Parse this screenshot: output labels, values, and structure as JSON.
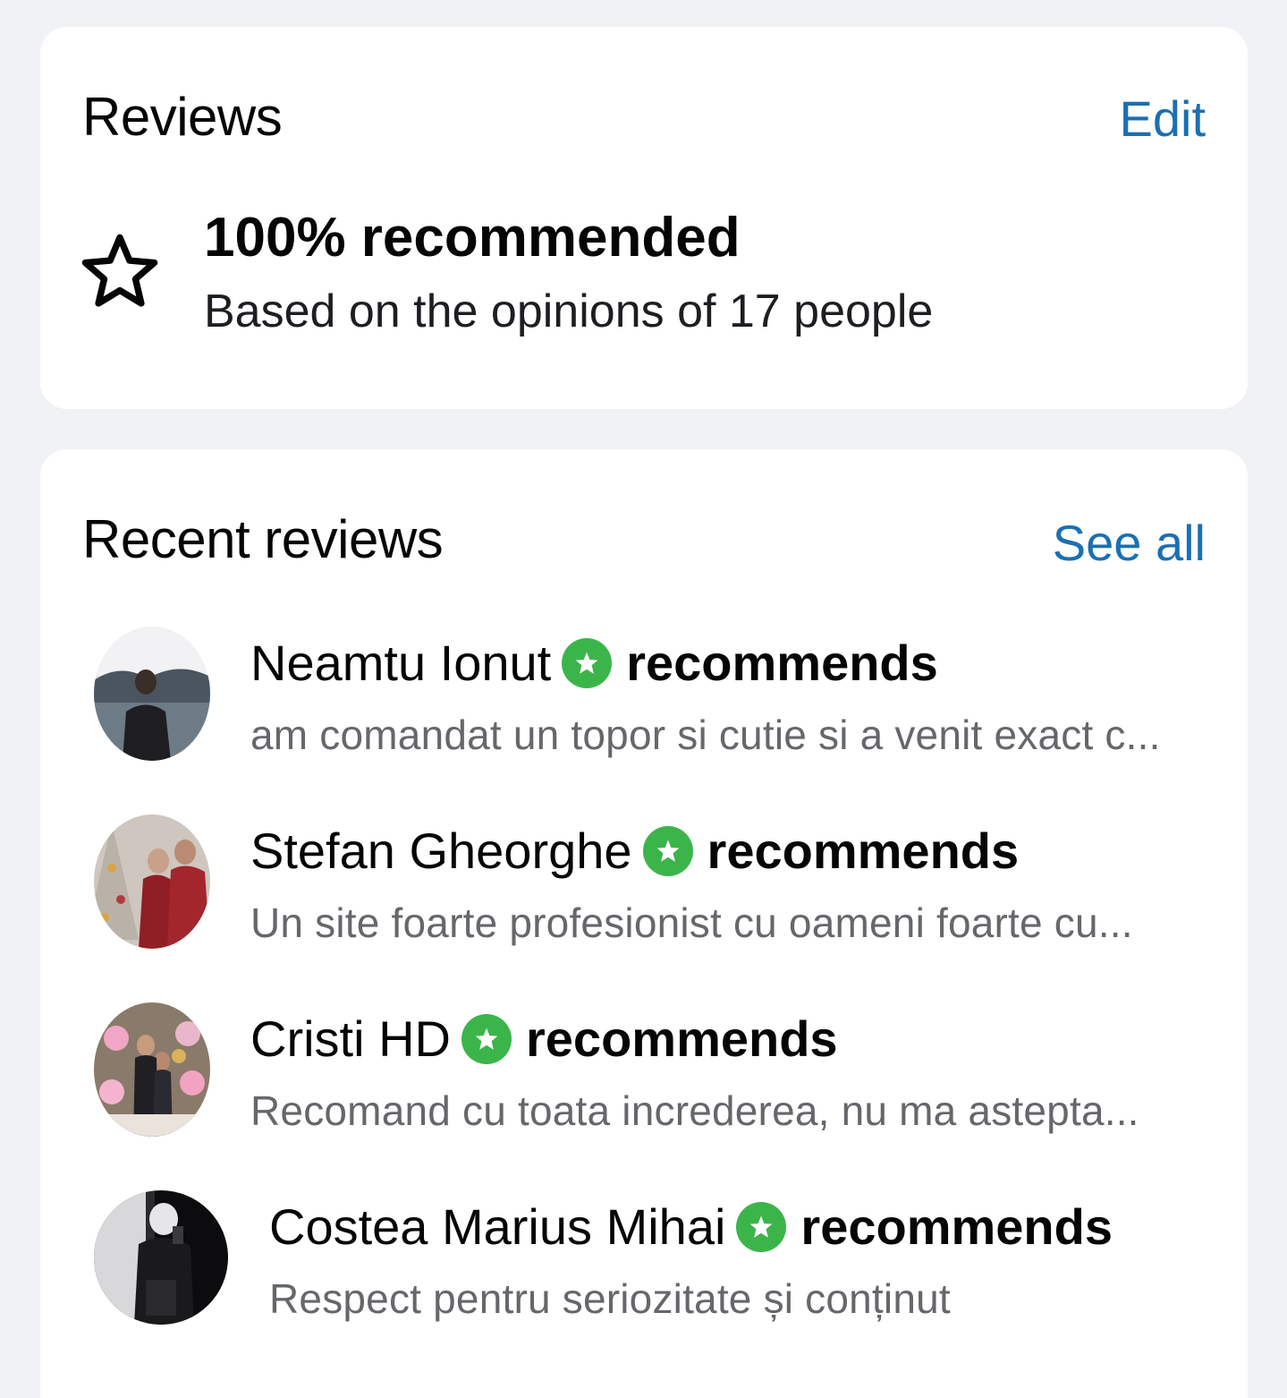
{
  "summary": {
    "title": "Reviews",
    "edit_label": "Edit",
    "headline": "100% recommended",
    "subtext": "Based on the opinions of 17 people",
    "icon": "star-outline-icon"
  },
  "recent": {
    "title": "Recent reviews",
    "see_all_label": "See all",
    "items": [
      {
        "name": "Neamtu Ionut",
        "verb": "recommends",
        "text": "am comandat un topor si cutie si a venit exact c..."
      },
      {
        "name": "Stefan Gheorghe",
        "verb": "recommends",
        "text": "Un site foarte profesionist cu oameni foarte cu..."
      },
      {
        "name": "Cristi HD",
        "verb": "recommends",
        "text": "Recomand cu toata increderea, nu ma astepta..."
      },
      {
        "name": "Costea Marius Mihai",
        "verb": "recommends",
        "text": "Respect pentru seriozitate și conținut"
      }
    ]
  },
  "colors": {
    "background": "#f0f2f5",
    "card": "#ffffff",
    "link": "#1b6fb3",
    "recommend_badge": "#3bb54a",
    "secondary_text": "#65676b"
  }
}
